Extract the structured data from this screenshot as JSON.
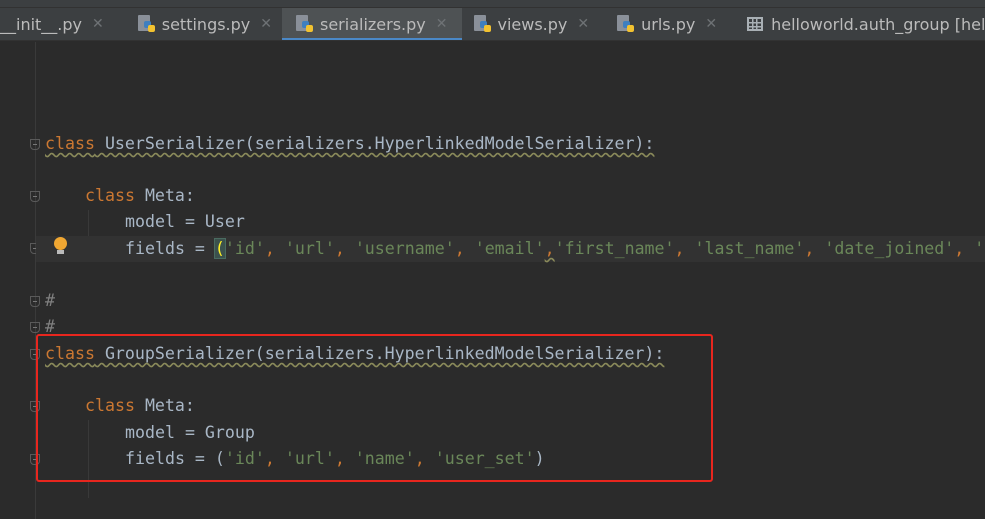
{
  "tabs": [
    {
      "label": "__init__.py",
      "icon": "python-file-icon",
      "active": false
    },
    {
      "label": "settings.py",
      "icon": "python-file-icon",
      "active": false
    },
    {
      "label": "serializers.py",
      "icon": "python-file-icon",
      "active": true
    },
    {
      "label": "views.py",
      "icon": "python-file-icon",
      "active": false
    },
    {
      "label": "urls.py",
      "icon": "python-file-icon",
      "active": false
    },
    {
      "label": "helloworld.auth_group [helloworld@localhost]",
      "icon": "table-icon",
      "active": false
    }
  ],
  "code": {
    "l1": {
      "kw": "class",
      "name": " UserSerializer(serializers.HyperlinkedModelSerializer):"
    },
    "l2": {
      "kw": "class",
      "name": " Meta:"
    },
    "l3": "model = User",
    "l4": {
      "pre": "fields = ",
      "open": "(",
      "s1": "'id'",
      "s2": "'url'",
      "s3": "'username'",
      "s4": "'email'",
      "s5": "'first_name'",
      "s6": "'last_name'",
      "s7": "'date_joined'",
      "s8": "'"
    },
    "l5": "#",
    "l6": "#",
    "l7": {
      "kw": "class",
      "name": " GroupSerializer(serializers.HyperlinkedModelSerializer):"
    },
    "l8": {
      "kw": "class",
      "name": " Meta:"
    },
    "l9": "model = Group",
    "l10": {
      "pre": "fields = (",
      "s1": "'id'",
      "s2": "'url'",
      "s3": "'name'",
      "s4": "'user_set'",
      "close": ")"
    },
    "comma": ", "
  },
  "colors": {
    "keyword": "#cc7832",
    "string": "#6a8759",
    "text": "#a9b7c6",
    "highlight_box": "#e8261e",
    "active_tab_underline": "#4a88c7"
  }
}
